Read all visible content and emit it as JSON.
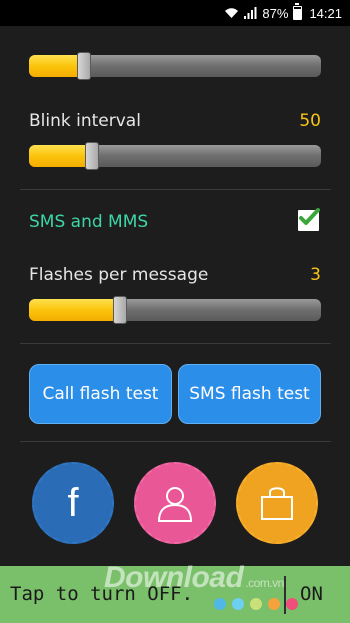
{
  "status_bar": {
    "battery_text": "87%",
    "time": "14:21",
    "icons": [
      "wifi-icon",
      "signal-icon",
      "battery-icon"
    ]
  },
  "settings": {
    "slider_top": {
      "fill_fraction": 0.19
    },
    "blink_interval": {
      "label": "Blink interval",
      "value": "50",
      "fill_fraction": 0.215
    },
    "sms_mms": {
      "label": "SMS and MMS",
      "checked": true
    },
    "flashes_per_message": {
      "label": "Flashes per message",
      "value": "3",
      "fill_fraction": 0.31
    }
  },
  "buttons": {
    "call_flash_test": "Call flash test",
    "sms_flash_test": "SMS flash test"
  },
  "circles": {
    "facebook": {
      "glyph": "f",
      "icon": "facebook-icon"
    },
    "user": {
      "icon": "user-icon"
    },
    "shop": {
      "icon": "shopping-bag-icon"
    }
  },
  "bottom_bar": {
    "text": "Tap to turn OFF.",
    "toggle": "ON"
  },
  "watermark": {
    "text": "Download",
    "suffix": ".com.vn"
  },
  "colors": {
    "accent_yellow": "#f7c418",
    "sms_label": "#3dd6a6",
    "button_blue": "#2b8ee8",
    "bottom_bar_green": "#7ac06a",
    "dots": [
      "#4fb8e8",
      "#6ed0f0",
      "#c9e07a",
      "#f6a23c",
      "#f04f7a"
    ]
  }
}
